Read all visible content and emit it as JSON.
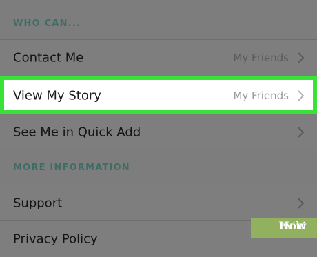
{
  "sections": {
    "who_can": {
      "header": "WHO CAN..."
    },
    "more_information": {
      "header": "MORE INFORMATION"
    }
  },
  "rows": {
    "contact_me": {
      "label": "Contact Me",
      "value": "My Friends"
    },
    "view_my_story": {
      "label": "View My Story",
      "value": "My Friends"
    },
    "quick_add": {
      "label": "See Me in Quick Add"
    },
    "support": {
      "label": "Support"
    },
    "privacy_policy": {
      "label": "Privacy Policy"
    }
  },
  "watermark": {
    "prefix": "wiki",
    "suffix": "How"
  },
  "colors": {
    "highlight_outline": "#38e236",
    "section_header": "#3f6d64",
    "overlay_background": "#7d7d7d",
    "watermark_background": "#92b15e"
  },
  "icons": {
    "chevron": "chevron-right-icon"
  }
}
